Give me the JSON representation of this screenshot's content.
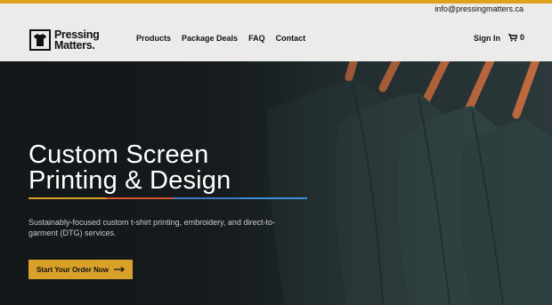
{
  "topbar": {
    "email": "info@pressingmatters.ca"
  },
  "brand": {
    "line1": "Pressing",
    "line2": "Matters."
  },
  "nav": {
    "items": [
      "Products",
      "Package Deals",
      "FAQ",
      "Contact"
    ]
  },
  "account": {
    "signin": "Sign In",
    "cart_count": "0"
  },
  "hero": {
    "title_line1": "Custom Screen",
    "title_line2": "Printing & Design",
    "subtitle": "Sustainably-focused custom t-shirt printing, embroidery, and direct-to-garment (DTG) services.",
    "cta_label": "Start Your Order Now"
  },
  "colors": {
    "accent": "#e0a21c",
    "cta": "#d9a12a",
    "rule": [
      "#d4a22a",
      "#d2552b",
      "#3b7ac0",
      "#3e8dd6"
    ]
  },
  "icons": {
    "logo": "tshirt-icon",
    "cart": "cart-icon",
    "cta_arrow": "arrow-right-icon"
  }
}
